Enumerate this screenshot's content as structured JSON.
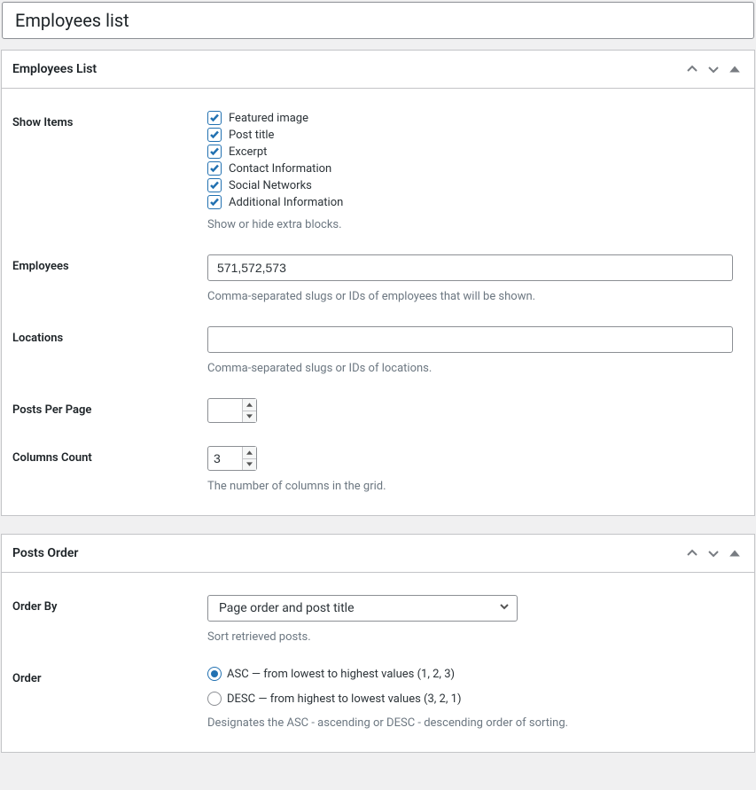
{
  "title": "Employees list",
  "panel1": {
    "heading": "Employees List",
    "showItems": {
      "label": "Show Items",
      "options": [
        "Featured image",
        "Post title",
        "Excerpt",
        "Contact Information",
        "Social Networks",
        "Additional Information"
      ],
      "help": "Show or hide extra blocks."
    },
    "employees": {
      "label": "Employees",
      "value": "571,572,573",
      "help": "Comma-separated slugs or IDs of employees that will be shown."
    },
    "locations": {
      "label": "Locations",
      "value": "",
      "help": "Comma-separated slugs or IDs of locations."
    },
    "postsPerPage": {
      "label": "Posts Per Page",
      "value": ""
    },
    "columnsCount": {
      "label": "Columns Count",
      "value": "3",
      "help": "The number of columns in the grid."
    }
  },
  "panel2": {
    "heading": "Posts Order",
    "orderBy": {
      "label": "Order By",
      "value": "Page order and post title",
      "help": "Sort retrieved posts."
    },
    "order": {
      "label": "Order",
      "asc": "ASC — from lowest to highest values (1, 2, 3)",
      "desc": "DESC — from highest to lowest values (3, 2, 1)",
      "help": "Designates the ASC - ascending or DESC - descending order of sorting."
    }
  }
}
